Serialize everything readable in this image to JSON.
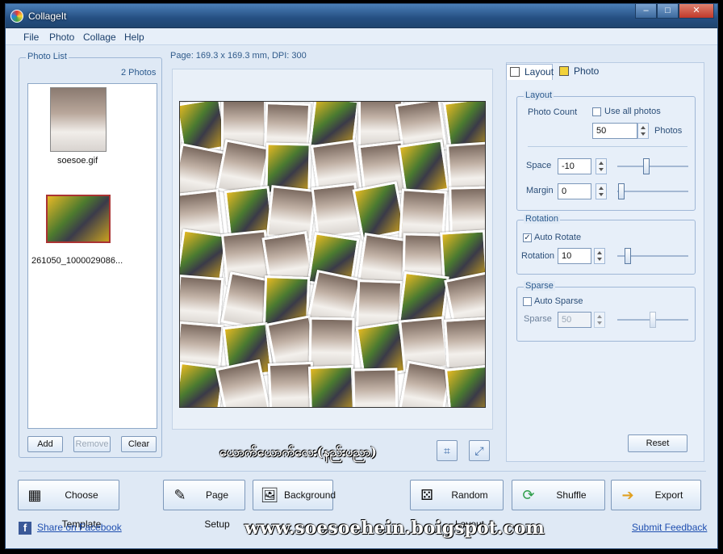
{
  "window": {
    "title": "CollageIt"
  },
  "menu": [
    "File",
    "Photo",
    "Collage",
    "Help"
  ],
  "page_info": "Page: 169.3 x 169.3 mm, DPI: 300",
  "photo_list": {
    "title": "Photo List",
    "count": "2 Photos",
    "items": [
      {
        "label": "soesoe.gif"
      },
      {
        "label": "261050_1000029086..."
      }
    ],
    "buttons": {
      "add": "Add",
      "remove": "Remove",
      "clear": "Clear"
    }
  },
  "tabs": {
    "layout": "Layout",
    "photo": "Photo"
  },
  "layout_group": {
    "title": "Layout",
    "photo_count_label": "Photo Count",
    "use_all_label": "Use all photos",
    "photo_count_value": "50",
    "photos_unit": "Photos",
    "space_label": "Space",
    "space_value": "-10",
    "margin_label": "Margin",
    "margin_value": "0"
  },
  "rotation_group": {
    "title": "Rotation",
    "auto_rotate_label": "Auto Rotate",
    "auto_rotate_checked": true,
    "rotation_label": "Rotation",
    "rotation_value": "10"
  },
  "sparse_group": {
    "title": "Sparse",
    "auto_sparse_label": "Auto Sparse",
    "auto_sparse_checked": false,
    "sparse_label": "Sparse",
    "sparse_value": "50"
  },
  "reset_label": "Reset",
  "overlay_caption": "ယောက်ယောက်လေး(နည်းပညာ)",
  "bottom_buttons": {
    "choose_template": "Choose Template",
    "page_setup": "Page Setup",
    "background": "Background",
    "random_layout": "Random Layout",
    "shuffle": "Shuffle",
    "export": "Export"
  },
  "links": {
    "facebook": "Share on Facebook",
    "feedback": "Submit Feedback"
  },
  "website_watermark": "www.soesoehein.boigspot.com",
  "icons": {
    "app": "collageit-logo-icon",
    "crop": "crop-icon",
    "fit": "fit-screen-icon"
  }
}
